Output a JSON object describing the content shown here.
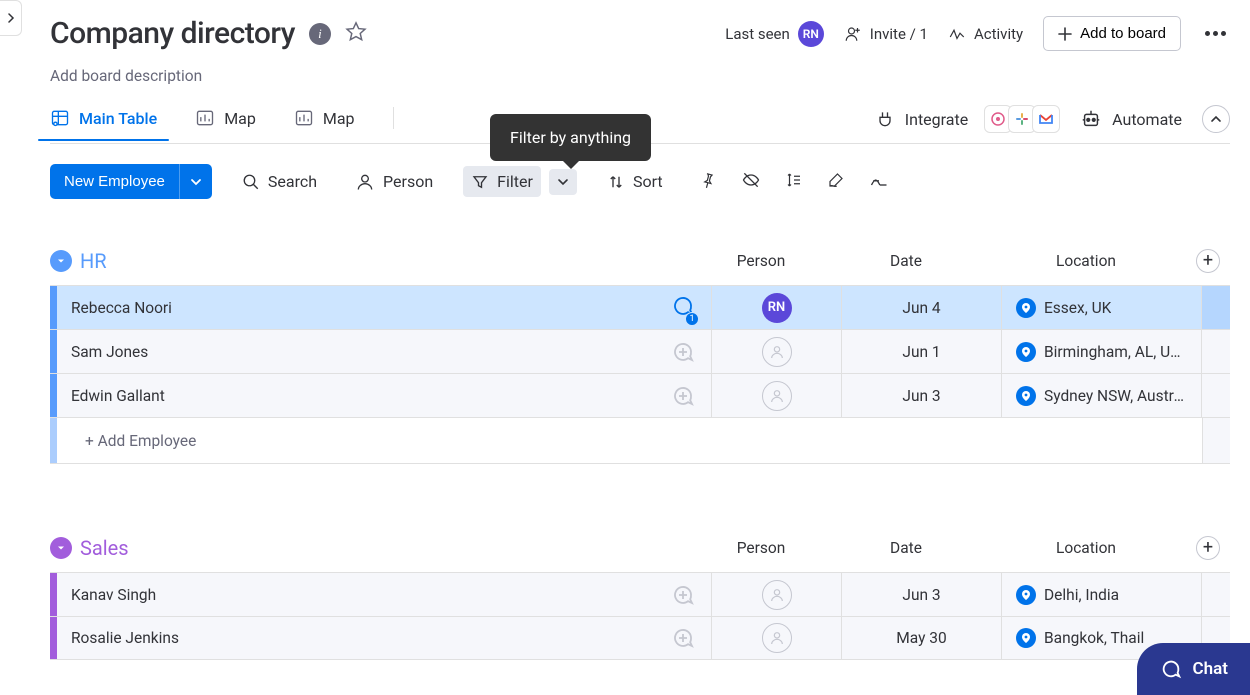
{
  "header": {
    "title": "Company directory",
    "description": "Add board description",
    "last_seen_label": "Last seen",
    "last_seen_avatar": "RN",
    "invite_label": "Invite / 1",
    "activity_label": "Activity",
    "add_to_board_label": "Add to board"
  },
  "tabs": [
    {
      "label": "Main Table",
      "icon": "table",
      "active": true
    },
    {
      "label": "Map",
      "icon": "chart",
      "active": false
    },
    {
      "label": "Map",
      "icon": "chart",
      "active": false
    }
  ],
  "tooltip": "Filter by anything",
  "integrate_label": "Integrate",
  "automate_label": "Automate",
  "toolbar": {
    "new_button": "New Employee",
    "search": "Search",
    "person": "Person",
    "filter": "Filter",
    "sort": "Sort"
  },
  "columns": {
    "person": "Person",
    "date": "Date",
    "location": "Location"
  },
  "groups": [
    {
      "name": "HR",
      "color": "#579bfc",
      "title_color": "#579bfc",
      "rows": [
        {
          "name": "Rebecca Noori",
          "chat_count": 1,
          "person_avatar": "RN",
          "date": "Jun 4",
          "location": "Essex, UK",
          "highlight": true
        },
        {
          "name": "Sam Jones",
          "chat_count": 0,
          "date": "Jun 1",
          "location": "Birmingham, AL, USA"
        },
        {
          "name": "Edwin Gallant",
          "chat_count": 0,
          "date": "Jun 3",
          "location": "Sydney NSW, Austral…"
        }
      ],
      "add_label": "+ Add Employee"
    },
    {
      "name": "Sales",
      "color": "#a25ddc",
      "title_color": "#a25ddc",
      "rows": [
        {
          "name": "Kanav Singh",
          "chat_count": 0,
          "date": "Jun 3",
          "location": "Delhi, India"
        },
        {
          "name": "Rosalie Jenkins",
          "chat_count": 0,
          "date": "May 30",
          "location": "Bangkok, Thail"
        }
      ]
    }
  ],
  "chat_widget": "Chat"
}
